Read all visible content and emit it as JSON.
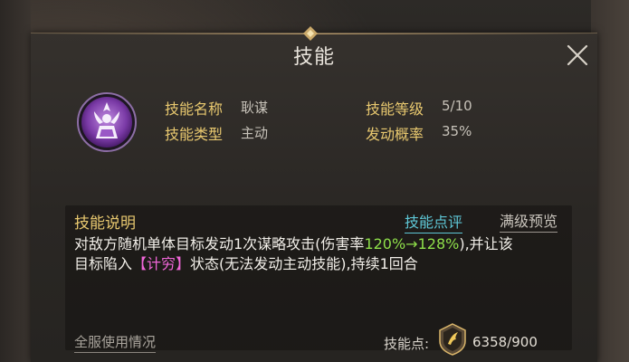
{
  "dialog": {
    "title": "技能",
    "close_icon": "close-icon"
  },
  "skill": {
    "icon": "skill-emblem-icon",
    "name_label": "技能名称",
    "name_value": "耿谋",
    "type_label": "技能类型",
    "type_value": "主动",
    "level_label": "技能等级",
    "level_value": "5/10",
    "chance_label": "发动概率",
    "chance_value": "35%"
  },
  "description": {
    "title": "技能说明",
    "review_link": "技能点评",
    "preview_link": "满级预览",
    "line1_prefix": "对敌方随机单体目标发动1次谋略攻击(伤害率",
    "line1_highlight": "120%→128%",
    "line1_suffix": "),并让该",
    "line2_prefix": "目标陷入",
    "line2_highlight": "【计穷】",
    "line2_suffix": "状态(无法发动主动技能),持续1回合"
  },
  "footer": {
    "usage_link": "全服使用情况",
    "points_label": "技能点:",
    "points_icon": "skill-point-icon",
    "points_value": "6358/900"
  },
  "colors": {
    "label_gold": "#e8c86f",
    "highlight_green": "#8fe04a",
    "highlight_magenta": "#f066d8",
    "link_cyan": "#5ec7d6"
  }
}
